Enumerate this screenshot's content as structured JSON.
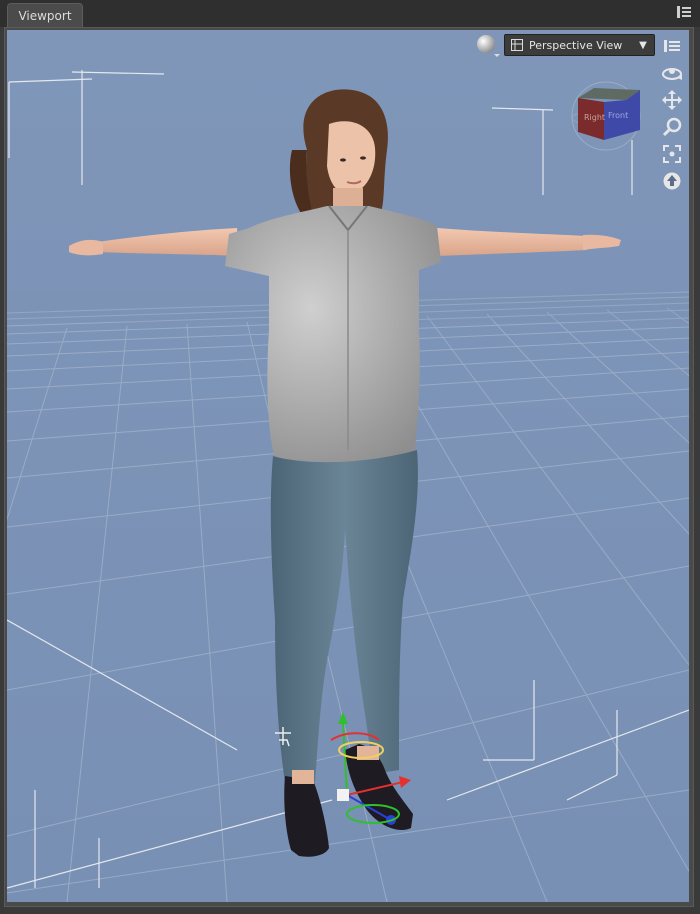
{
  "tab": {
    "title": "Viewport"
  },
  "view": {
    "selected": "Perspective View"
  },
  "cube": {
    "left_label": "Right",
    "front_label": "Front"
  },
  "icons": {
    "panel_menu": "panel-menu-icon",
    "draw_style": "draw-style-sphere-icon",
    "view_layout": "view-layout-icon",
    "dropdown": "chevron-down-icon",
    "orbit": "orbit-icon",
    "pan": "pan-icon",
    "zoom": "zoom-icon",
    "frame": "frame-icon",
    "aim": "aim-icon",
    "options": "viewport-options-icon"
  },
  "colors": {
    "sky": "#7e95b8",
    "floor": "#7b91b2",
    "grid": "#9fb0c9",
    "shirt": "#a9a9a9",
    "jeans": "#5a7486",
    "skin": "#e8b9a0",
    "hair": "#5a3a26",
    "x_axis": "#e53030",
    "y_axis": "#2fbf2f",
    "z_axis": "#2a40d8"
  }
}
